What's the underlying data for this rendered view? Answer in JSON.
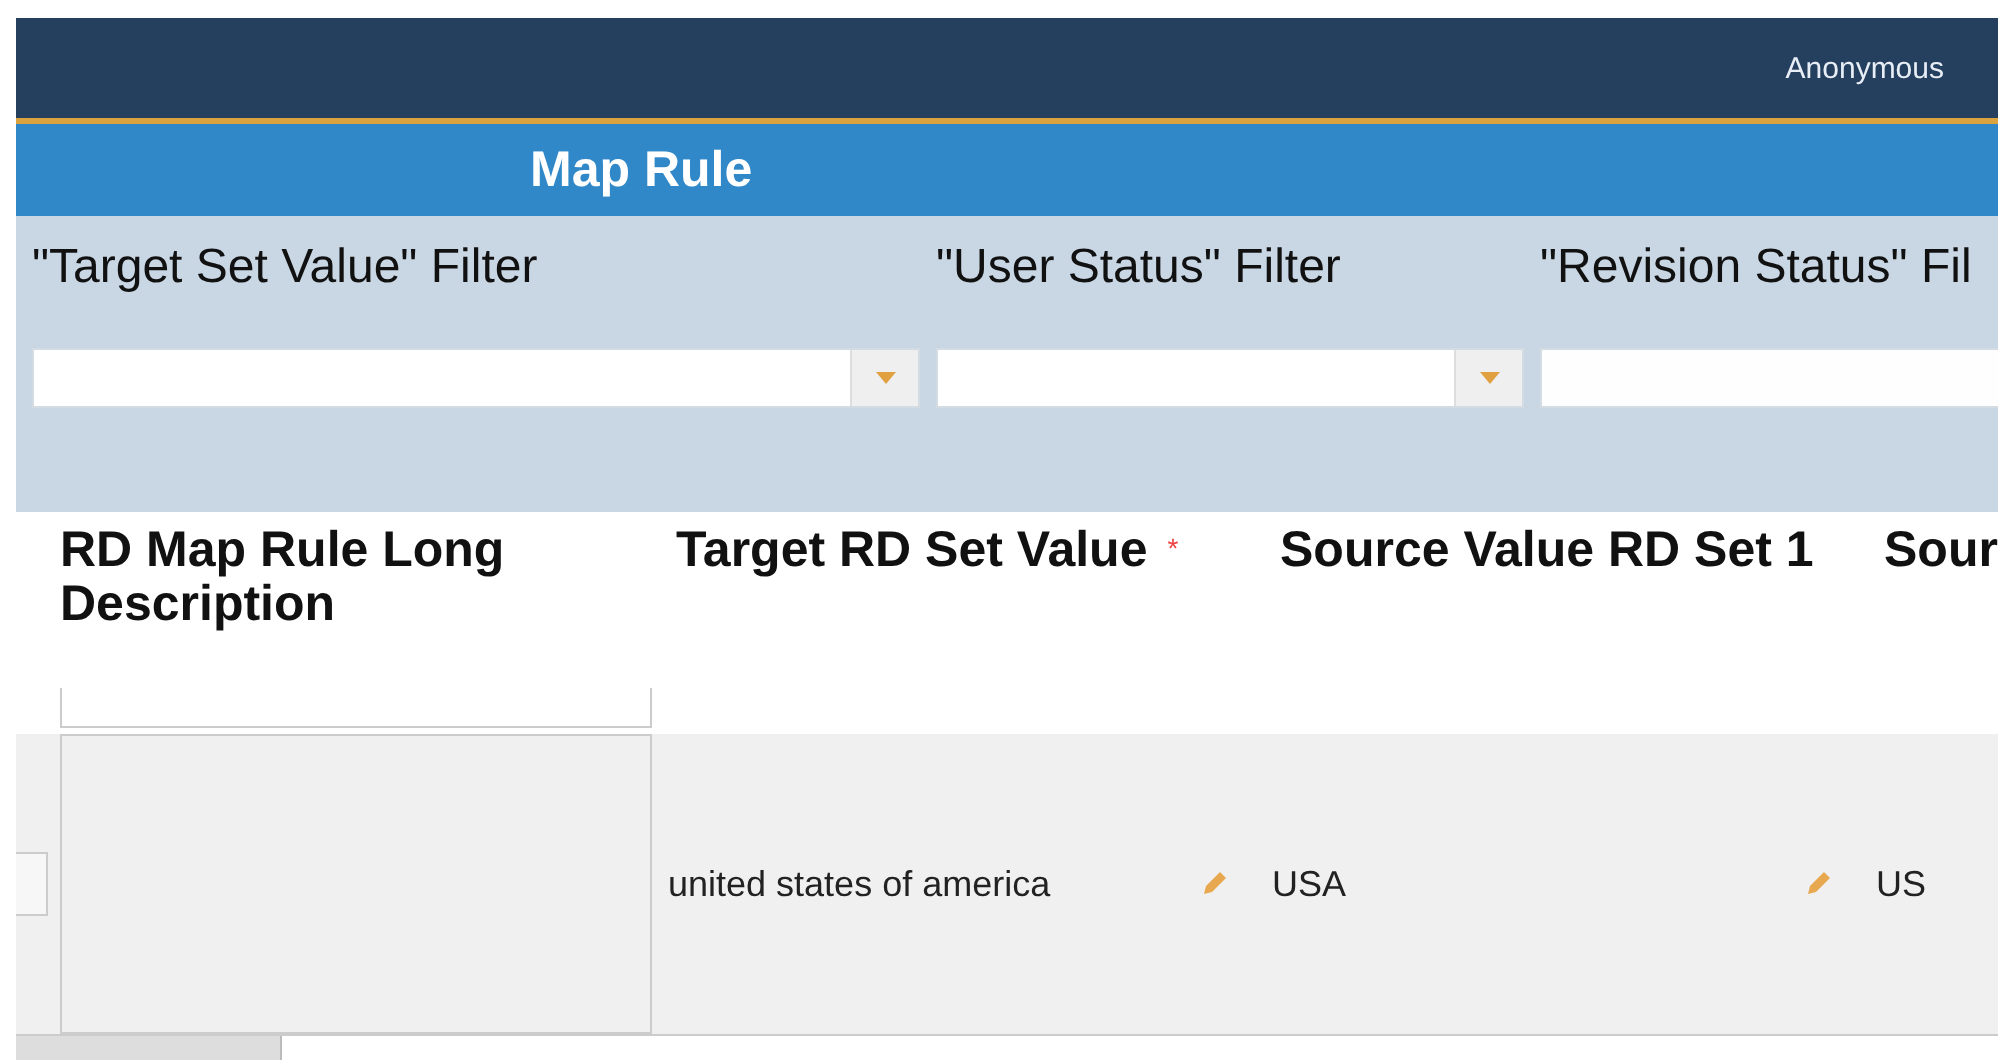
{
  "header": {
    "user": "Anonymous"
  },
  "title": "Map Rule",
  "filters": [
    {
      "label": "\"Target Set Value\" Filter",
      "dropdown": true
    },
    {
      "label": "\"User Status\" Filter",
      "dropdown": true
    },
    {
      "label": "\"Revision Status\" Fil"
    }
  ],
  "table": {
    "columns": [
      {
        "label": "RD Map Rule Long Description"
      },
      {
        "label": "Target RD Set Value",
        "marker": "*"
      },
      {
        "label": "Source Value RD Set 1"
      },
      {
        "label": "Sour"
      }
    ],
    "rows": [
      {
        "cells": [
          {
            "kind": "textarea"
          },
          {
            "kind": "text",
            "value": "united states of america",
            "editable": true
          },
          {
            "kind": "text",
            "value": "USA",
            "editable": true
          },
          {
            "kind": "text",
            "value": "US"
          }
        ]
      }
    ]
  }
}
